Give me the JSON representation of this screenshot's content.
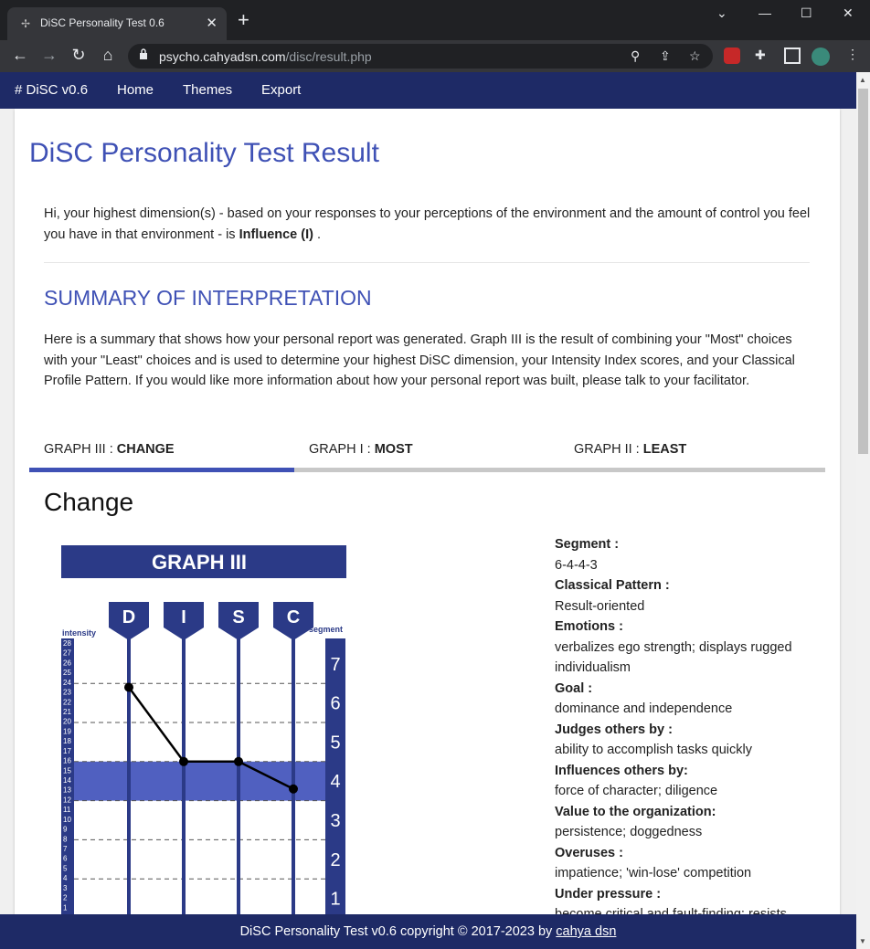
{
  "browser": {
    "tab_title": "DiSC Personality Test 0.6",
    "url_host": "psycho.cahyadsn.com",
    "url_path": "/disc/result.php"
  },
  "nav": {
    "brand": "# DiSC v0.6",
    "home": "Home",
    "themes": "Themes",
    "export": "Export"
  },
  "page": {
    "title": "DiSC Personality Test Result",
    "intro_prefix": "Hi, your highest dimension(s) - based on your responses to your perceptions of the environment and the amount of control you feel you have in that environment - is ",
    "intro_highlight": "Influence (I)",
    "intro_suffix": " .",
    "summary_heading": "SUMMARY OF INTERPRETATION",
    "summary_text": "Here is a summary that shows how your personal report was generated. Graph III is the result of combining your \"Most\" choices with your \"Least\" choices and is used to determine your highest DiSC dimension, your Intensity Index scores, and your Classical Profile Pattern. If you would like more information about how your personal report was built, please talk to your facilitator."
  },
  "tabs": [
    {
      "prefix": "GRAPH III : ",
      "label": "CHANGE"
    },
    {
      "prefix": "GRAPH I : ",
      "label": "MOST"
    },
    {
      "prefix": "GRAPH II : ",
      "label": "LEAST"
    }
  ],
  "section_title": "Change",
  "graph": {
    "title": "GRAPH III",
    "dims": [
      "D",
      "I",
      "S",
      "C"
    ],
    "intensity_label": "intensity",
    "segment_label": "segment",
    "intensity_ticks": [
      "28",
      "27",
      "26",
      "25",
      "24",
      "23",
      "22",
      "21",
      "20",
      "19",
      "18",
      "17",
      "16",
      "15",
      "14",
      "13",
      "12",
      "11",
      "10",
      "9",
      "8",
      "7",
      "6",
      "5",
      "4",
      "3",
      "2",
      "1"
    ],
    "segment_ticks": [
      "7",
      "6",
      "5",
      "4",
      "3",
      "2",
      "1"
    ],
    "colors": {
      "primary": "#2b3a87",
      "band": "#5060c0",
      "dash": "#555"
    }
  },
  "chart_data": {
    "type": "line",
    "title": "GRAPH III",
    "categories": [
      "D",
      "I",
      "S",
      "C"
    ],
    "series": [
      {
        "values": [
          5.9,
          4,
          4,
          3.3
        ]
      }
    ],
    "ylabel": "segment",
    "ylim": [
      0,
      7
    ]
  },
  "details": [
    {
      "label": "Segment :",
      "value": "6-4-4-3"
    },
    {
      "label": "Classical Pattern :",
      "value": "Result-oriented"
    },
    {
      "label": "Emotions :",
      "value": "verbalizes ego strength; displays rugged individualism"
    },
    {
      "label": "Goal :",
      "value": "dominance and independence"
    },
    {
      "label": "Judges others by :",
      "value": "ability to accomplish tasks quickly"
    },
    {
      "label": "Influences others by:",
      "value": "force of character; diligence"
    },
    {
      "label": "Value to the organization:",
      "value": "persistence; doggedness"
    },
    {
      "label": "Overuses :",
      "value": "impatience; 'win-lose' competition"
    },
    {
      "label": "Under pressure :",
      "value": "become critical and fault-finding; resists"
    }
  ],
  "footer": {
    "text": "DiSC Personality Test v0.6 copyright © 2017-2023 by ",
    "link": "cahya dsn"
  }
}
